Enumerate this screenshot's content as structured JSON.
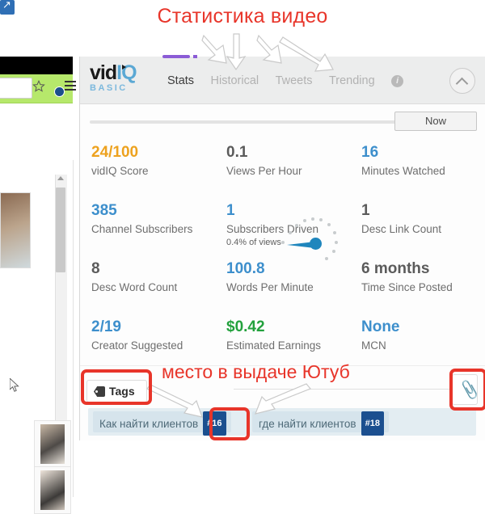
{
  "annotations": {
    "title": "Статистика видео",
    "subtitle": "место в выдаче Ютуб",
    "color": "#e8352a"
  },
  "browser": {
    "star_icon": "star-icon",
    "extension_icon": "vidiq-extension-icon",
    "menu_icon": "hamburger-menu-icon",
    "toolbar_color": "#b6e86b"
  },
  "panel": {
    "logo": {
      "part1": "vid",
      "part2": "IQ",
      "tagline": "BASIC"
    },
    "tabs": [
      {
        "label": "Stats",
        "active": true
      },
      {
        "label": "Historical",
        "active": false
      },
      {
        "label": "Tweets",
        "active": false
      },
      {
        "label": "Trending",
        "active": false
      }
    ],
    "info_icon_label": "i",
    "collapse_icon": "chevron-up-icon",
    "timeline": {
      "button_label": "Now"
    },
    "stats": [
      {
        "value": "24/100",
        "label": "vidIQ Score",
        "sub": "",
        "color": "#eda21f"
      },
      {
        "value": "0.1",
        "label": "Views Per Hour",
        "sub": "",
        "color": "#5b5b5b"
      },
      {
        "value": "16",
        "label": "Minutes Watched",
        "sub": "",
        "color": "#3d8fcc"
      },
      {
        "value": "385",
        "label": "Channel Subscribers",
        "sub": "",
        "color": "#3d8fcc"
      },
      {
        "value": "1",
        "label": "Subscribers Driven",
        "sub": "0.4% of views",
        "color": "#3d8fcc"
      },
      {
        "value": "1",
        "label": "Desc Link Count",
        "sub": "",
        "color": "#5b5b5b"
      },
      {
        "value": "8",
        "label": "Desc Word Count",
        "sub": "",
        "color": "#5b5b5b"
      },
      {
        "value": "100.8",
        "label": "Words Per Minute",
        "sub": "",
        "color": "#3d8fcc"
      },
      {
        "value": "6 months",
        "label": "Time Since Posted",
        "sub": "",
        "color": "#5b5b5b"
      },
      {
        "value": "2/19",
        "label": "Creator Suggested",
        "sub": "",
        "color": "#3d8fcc"
      },
      {
        "value": "$0.42",
        "label": "Estimated Earnings",
        "sub": "",
        "color": "#23a13d"
      },
      {
        "value": "None",
        "label": "MCN",
        "sub": "",
        "color": "#3d8fcc"
      }
    ],
    "tags": {
      "section_label": "Tags",
      "tag_icon": "price-tag-icon",
      "attach_icon": "paperclip-icon",
      "chips": [
        {
          "text": "Как найти клиентов",
          "rank": "#16"
        },
        {
          "text": "где найти клиентов",
          "rank": "#18"
        }
      ]
    }
  }
}
